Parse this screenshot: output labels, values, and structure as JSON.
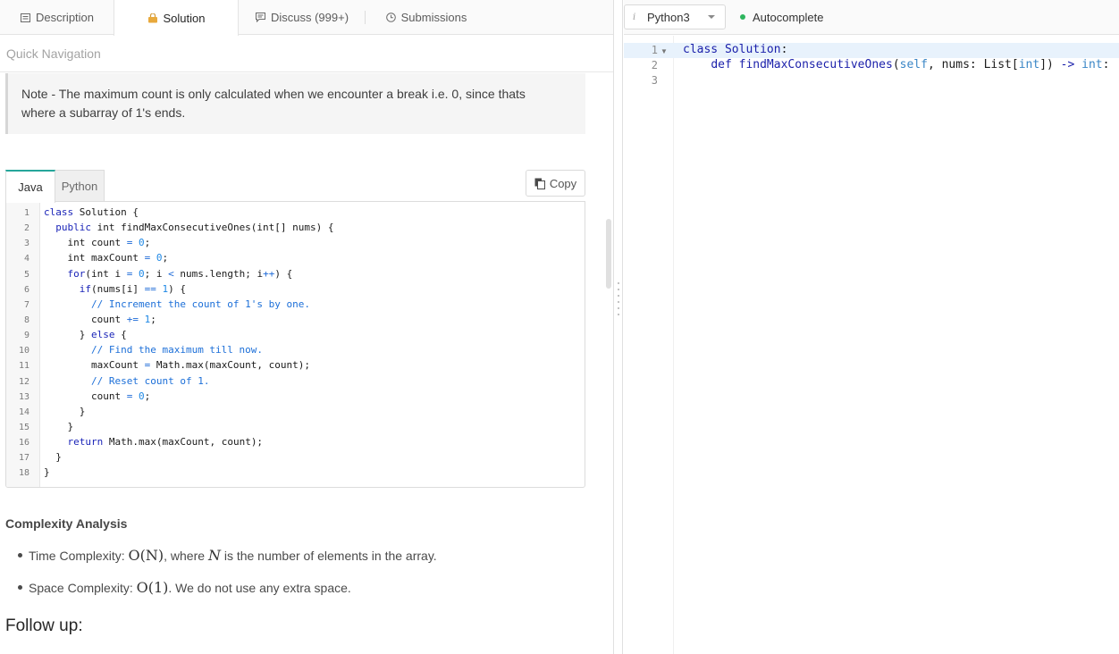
{
  "tabs": [
    {
      "label": "Description",
      "icon": "description-icon"
    },
    {
      "label": "Solution",
      "icon": "solution-lock-icon",
      "active": true
    },
    {
      "label": "Discuss (999+)",
      "icon": "discuss-icon"
    },
    {
      "label": "Submissions",
      "icon": "submissions-clock-icon"
    }
  ],
  "quick_nav": "Quick Navigation",
  "note": {
    "line1": "Note - The maximum count is only calculated when we encounter a break i.e. 0, since thats",
    "line2": "where a subarray of 1's ends."
  },
  "code_tabs": [
    "Java",
    "Python"
  ],
  "copy_label": "Copy",
  "java_code": {
    "line_numbers": [
      "1",
      "2",
      "3",
      "4",
      "5",
      "6",
      "7",
      "8",
      "9",
      "10",
      "11",
      "12",
      "13",
      "14",
      "15",
      "16",
      "17",
      "18"
    ]
  },
  "complexity": {
    "title": "Complexity Analysis",
    "time_prefix": "Time Complexity: ",
    "time_math": "O(N)",
    "time_mid": ", where ",
    "time_var": "N",
    "time_suffix": " is the number of elements in the array.",
    "space_prefix": "Space Complexity: ",
    "space_math": "O(1)",
    "space_suffix": ". We do not use any extra space."
  },
  "follow_up": "Follow up:",
  "editor": {
    "language": "Python3",
    "language_info_glyph": "i",
    "autocomplete_label": "Autocomplete",
    "autocomplete_status_color": "#2db55d",
    "line_numbers": [
      "1",
      "2",
      "3"
    ],
    "current_line": 1
  },
  "colors": {
    "active_tab_accent": "#26a69a",
    "keyword_blue": "#1a24b8",
    "comment_blue": "#1c6fd8",
    "editor_current_line_bg": "#e8f2fc"
  }
}
